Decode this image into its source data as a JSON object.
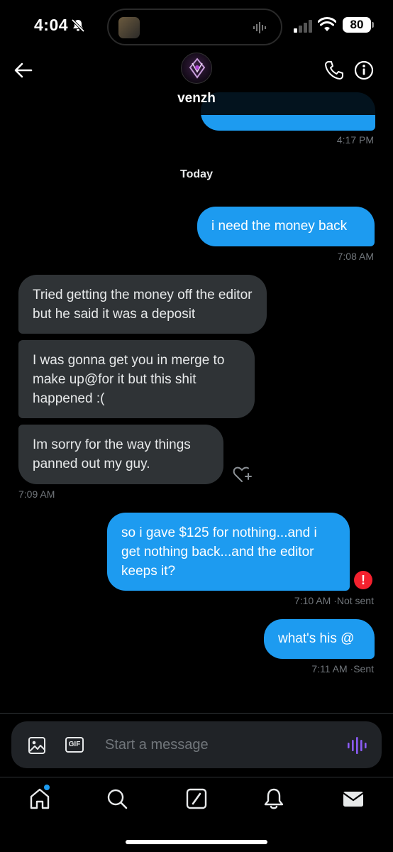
{
  "status_bar": {
    "time": "4:04",
    "battery": "80"
  },
  "header": {
    "contact_name": "venzh"
  },
  "messages": [
    {
      "text": "",
      "time": "4:17 PM"
    },
    {
      "text": "i need the money back",
      "time": "7:08 AM"
    },
    {
      "text": "Tried getting the money off the editor but he said it was a deposit"
    },
    {
      "text": "I was gonna get you in merge to make up@for it but this shit happened :("
    },
    {
      "text": "Im sorry for the way things panned out my guy.",
      "time": "7:09 AM"
    },
    {
      "text": "so i gave $125 for nothing...and i get nothing back...and the editor keeps it?",
      "time": "7:10 AM",
      "status": "·Not sent"
    },
    {
      "text": "what's his @",
      "time": "7:11 AM",
      "status": "·Sent"
    }
  ],
  "day_separator": "Today",
  "composer": {
    "placeholder": "Start a message",
    "gif_label": "GIF"
  },
  "error_icon": "!",
  "colors": {
    "outgoing": "#1d9bf0",
    "incoming": "#2f3336",
    "error": "#f4212e",
    "voice": "#8b5cf6"
  },
  "icons": [
    "back-arrow-icon",
    "phone-icon",
    "info-icon",
    "image-icon",
    "gif-icon",
    "voice-wave-icon",
    "home-icon",
    "search-icon",
    "compose-icon",
    "bell-icon",
    "mail-icon"
  ]
}
